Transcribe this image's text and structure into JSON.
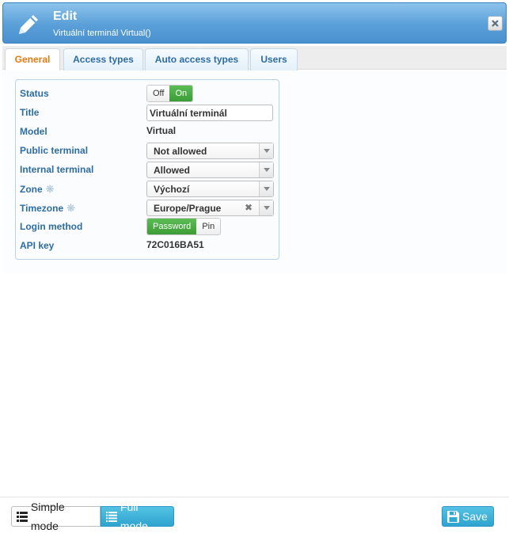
{
  "header": {
    "title": "Edit",
    "subtitle": "Virtuální terminál Virtual()",
    "icon": "pencil-icon",
    "close_icon": "close-icon"
  },
  "tabs": [
    {
      "label": "General",
      "active": true
    },
    {
      "label": "Access types",
      "active": false
    },
    {
      "label": "Auto access types",
      "active": false
    },
    {
      "label": "Users",
      "active": false
    }
  ],
  "form": {
    "status": {
      "label": "Status",
      "off": "Off",
      "on": "On",
      "selected": "On"
    },
    "title": {
      "label": "Title",
      "value": "Virtuální terminál"
    },
    "model": {
      "label": "Model",
      "value": "Virtual"
    },
    "public_terminal": {
      "label": "Public terminal",
      "value": "Not allowed"
    },
    "internal_terminal": {
      "label": "Internal terminal",
      "value": "Allowed"
    },
    "zone": {
      "label": "Zone",
      "value": "Výchozí",
      "required_marker": "❋"
    },
    "timezone": {
      "label": "Timezone",
      "value": "Europe/Prague",
      "required_marker": "❋",
      "clear": "✖"
    },
    "login_method": {
      "label": "Login method",
      "password": "Password",
      "pin": "Pin",
      "selected": "Password"
    },
    "api_key": {
      "label": "API key",
      "value": "72C016BA51"
    }
  },
  "footer": {
    "simple_mode": "Simple mode",
    "full_mode": "Full mode",
    "save": "Save",
    "active_mode": "Full mode"
  },
  "colors": {
    "header_blue": "#5a9fd8",
    "label_blue": "#2e6da4",
    "active_tab_orange": "#e37a14",
    "toggle_green": "#3c9c37",
    "button_cyan": "#2ea4cf"
  }
}
